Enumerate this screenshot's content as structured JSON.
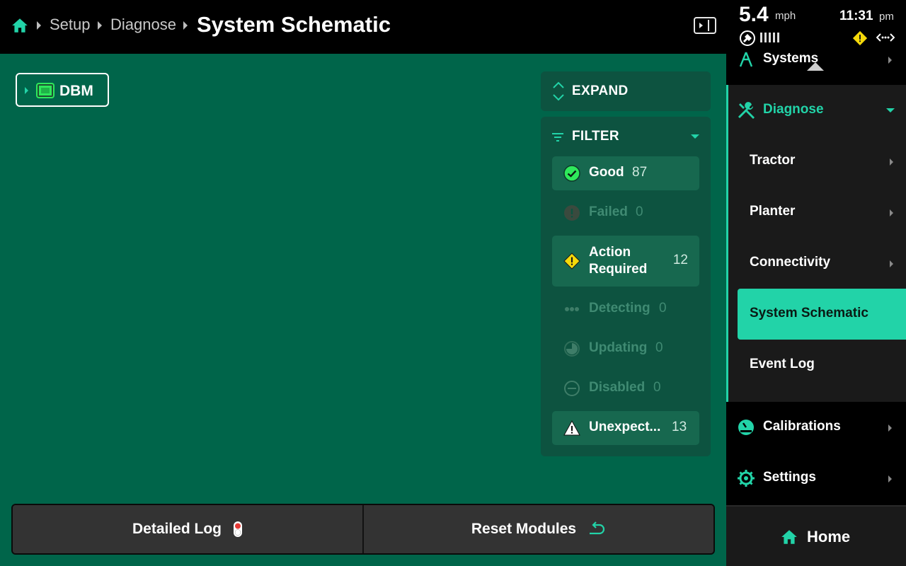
{
  "breadcrumb": {
    "items": [
      "Setup",
      "Diagnose"
    ],
    "title": "System Schematic"
  },
  "schematic": {
    "root_node": "DBM"
  },
  "controls": {
    "expand_label": "EXPAND",
    "filter_label": "FILTER"
  },
  "filters": [
    {
      "label": "Good",
      "count": "87",
      "icon": "check-circle-icon",
      "state": "active"
    },
    {
      "label": "Failed",
      "count": "0",
      "icon": "exclamation-circle-icon",
      "state": "dim"
    },
    {
      "label": "Action Required",
      "count": "12",
      "icon": "warning-diamond-icon",
      "state": "active"
    },
    {
      "label": "Detecting",
      "count": "0",
      "icon": "dots-icon",
      "state": "dim"
    },
    {
      "label": "Updating",
      "count": "0",
      "icon": "progress-circle-icon",
      "state": "dim"
    },
    {
      "label": "Disabled",
      "count": "0",
      "icon": "minus-circle-icon",
      "state": "dim"
    },
    {
      "label": "Unexpect...",
      "count": "13",
      "icon": "warning-triangle-icon",
      "state": "active"
    }
  ],
  "actions": {
    "detailed_log": "Detailed Log",
    "reset_modules": "Reset Modules"
  },
  "status": {
    "speed": "5.4",
    "speed_unit": "mph",
    "time": "11:31",
    "ampm": "pm"
  },
  "nav": {
    "systems": "Systems",
    "diagnose": "Diagnose",
    "sub": [
      "Tractor",
      "Planter",
      "Connectivity",
      "System Schematic",
      "Event Log"
    ],
    "calibrations": "Calibrations",
    "settings": "Settings",
    "home": "Home"
  },
  "colors": {
    "accent": "#22d3a8",
    "main_bg": "#00654a",
    "panel_bg": "#0d5340",
    "good": "#2ee85b",
    "warning": "#f5d90a"
  }
}
